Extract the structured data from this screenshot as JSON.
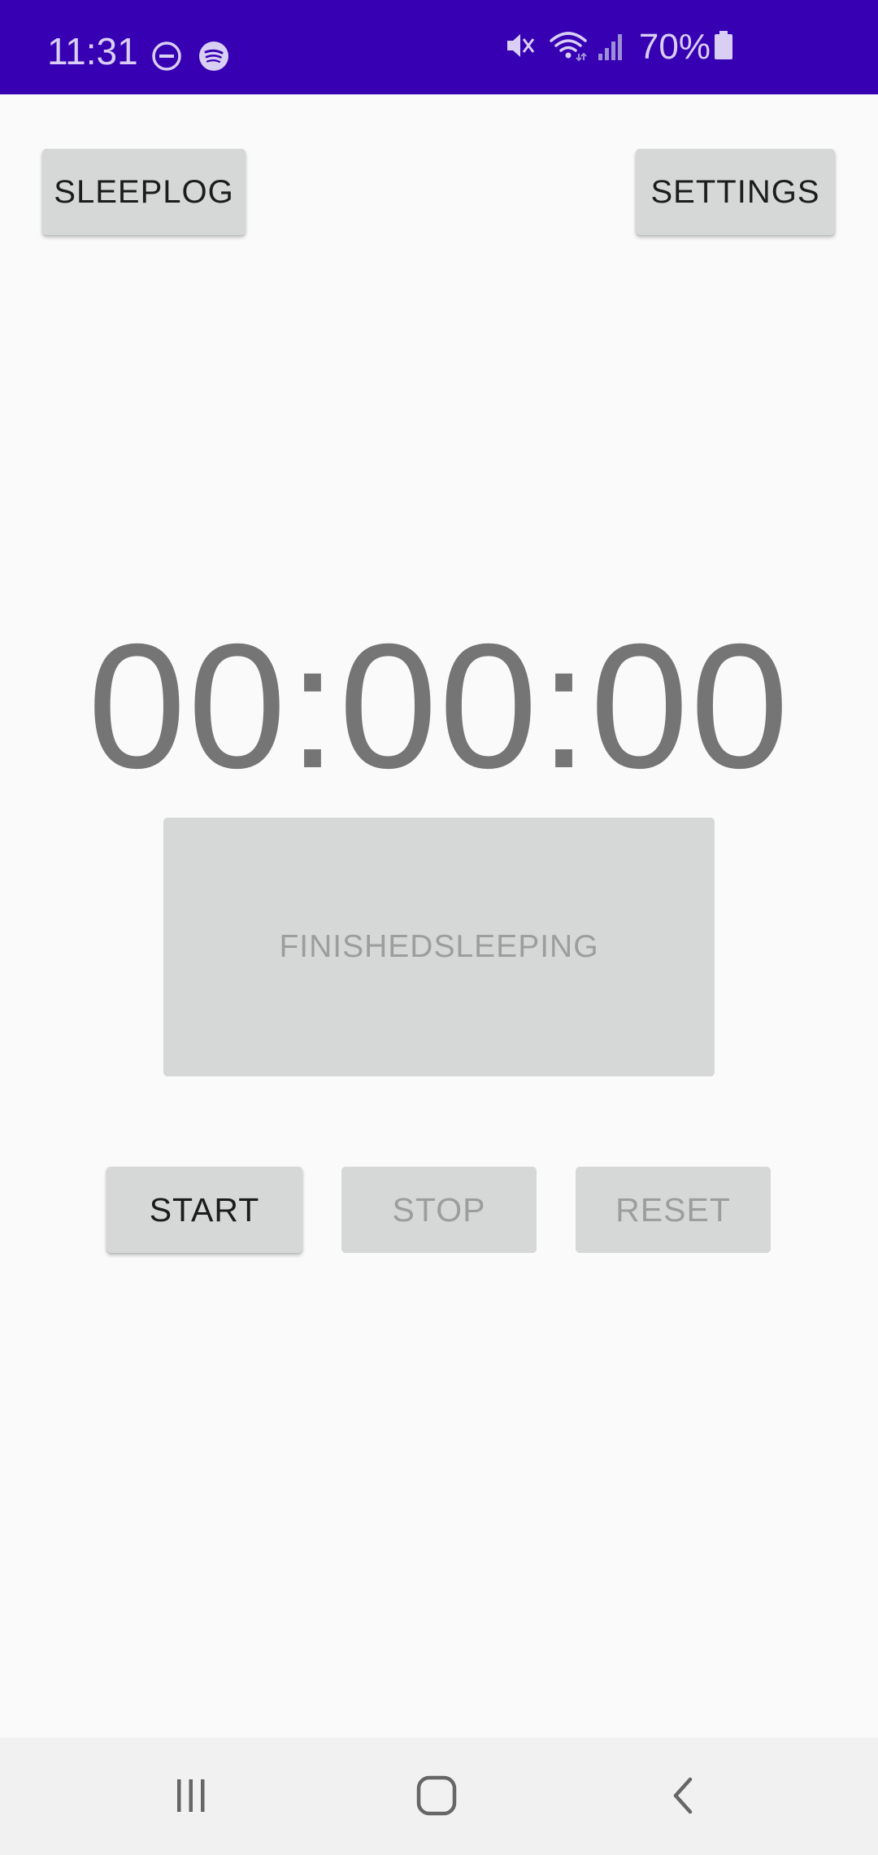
{
  "status_bar": {
    "time": "11:31",
    "battery_percent": "70%",
    "background_color": "#3700b3",
    "left_icons": [
      "do-not-disturb-icon",
      "spotify-icon"
    ],
    "right_icons": [
      "mute-icon",
      "wifi-icon",
      "signal-icon",
      "battery-icon"
    ]
  },
  "toolbar": {
    "sleeplog_label": "SLEEPLOG",
    "settings_label": "SETTINGS"
  },
  "timer": {
    "display": "00:00:00"
  },
  "main": {
    "finished_sleeping_label": "FINISHEDSLEEPING"
  },
  "controls": {
    "start_label": "START",
    "stop_label": "STOP",
    "reset_label": "RESET"
  },
  "nav_bar": {
    "icons": [
      "recents-icon",
      "home-icon",
      "back-icon"
    ]
  }
}
